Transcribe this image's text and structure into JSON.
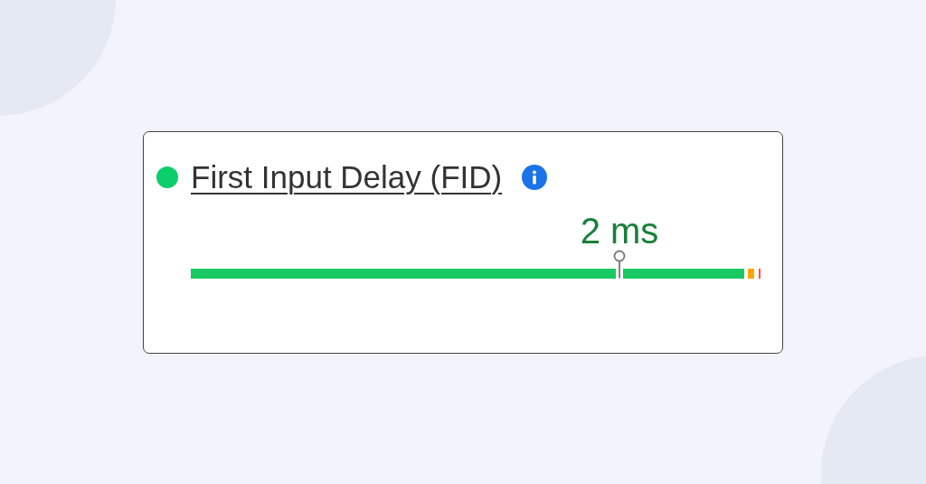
{
  "metric": {
    "title": "First Input Delay (FID)",
    "color": "#0cce6b",
    "value": "2 ms",
    "level": 0.75,
    "segments": [
      {
        "kind": "good"
      },
      {
        "kind": "average"
      },
      {
        "kind": "poor"
      }
    ]
  }
}
